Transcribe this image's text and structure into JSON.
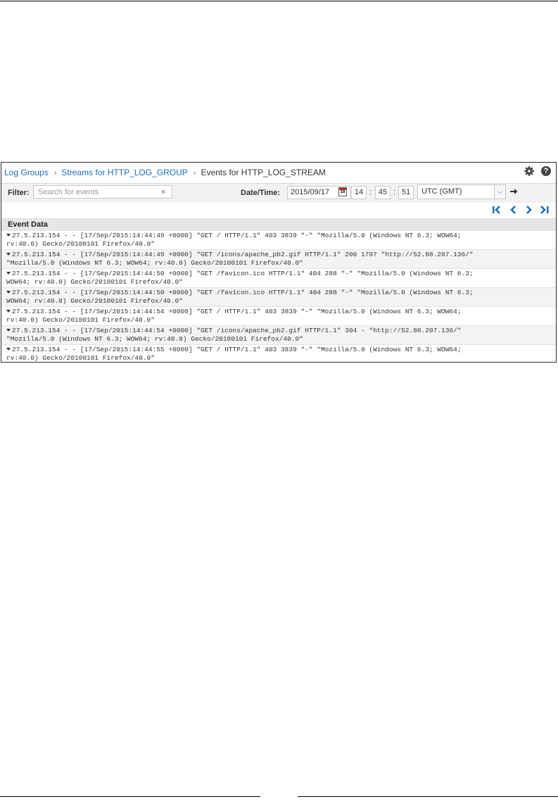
{
  "breadcrumb": {
    "log_groups": "Log Groups",
    "streams": "Streams for HTTP_LOG_GROUP",
    "events": "Events for HTTP_LOG_STREAM"
  },
  "filter": {
    "label": "Filter:",
    "placeholder": "Search for events",
    "clear_glyph": "×"
  },
  "datetime": {
    "label": "Date/Time:",
    "date": "2015/09/17",
    "calendar_day": "18",
    "hour": "14",
    "minute": "45",
    "second": "51",
    "separator": ":",
    "timezone": "UTC (GMT)"
  },
  "table": {
    "header": "Event Data"
  },
  "events": [
    {
      "line1": "27.5.213.154 - - [17/Sep/2015:14:44:49 +0000] \"GET / HTTP/1.1\" 403 3839 \"-\" \"Mozilla/5.0 (Windows NT 6.3; WOW64;",
      "line2": "rv:40.0) Gecko/20100101 Firefox/40.0\""
    },
    {
      "line1": "27.5.213.154 - - [17/Sep/2015:14:44:49 +0000] \"GET /icons/apache_pb2.gif HTTP/1.1\" 200 1797 \"http://52.88.207.136/\"",
      "line2": "\"Mozilla/5.0 (Windows NT 6.3; WOW64; rv:40.0) Gecko/20100101 Firefox/40.0\""
    },
    {
      "line1": "27.5.213.154 - - [17/Sep/2015:14:44:50 +0000] \"GET /favicon.ico HTTP/1.1\" 404 288 \"-\" \"Mozilla/5.0 (Windows NT 6.3;",
      "line2": "WOW64; rv:40.0) Gecko/20100101 Firefox/40.0\""
    },
    {
      "line1": "27.5.213.154 - - [17/Sep/2015:14:44:50 +0000] \"GET /favicon.ico HTTP/1.1\" 404 288 \"-\" \"Mozilla/5.0 (Windows NT 6.3;",
      "line2": "WOW64; rv:40.0) Gecko/20100101 Firefox/40.0\""
    },
    {
      "line1": "27.5.213.154 - - [17/Sep/2015:14:44:54 +0000] \"GET / HTTP/1.1\" 403 3839 \"-\" \"Mozilla/5.0 (Windows NT 6.3; WOW64;",
      "line2": "rv:40.0) Gecko/20100101 Firefox/40.0\""
    },
    {
      "line1": "27.5.213.154 - - [17/Sep/2015:14:44:54 +0000] \"GET /icons/apache_pb2.gif HTTP/1.1\" 304 - \"http://52.88.207.136/\"",
      "line2": "\"Mozilla/5.0 (Windows NT 6.3; WOW64; rv:40.0) Gecko/20100101 Firefox/40.0\""
    },
    {
      "line1": "27.5.213.154 - - [17/Sep/2015:14:44:55 +0000] \"GET / HTTP/1.1\" 403 3839 \"-\" \"Mozilla/5.0 (Windows NT 6.3; WOW64;",
      "line2": "rv:40.0) Gecko/20100101 Firefox/40.0\""
    }
  ],
  "icons": {
    "settings": "gear-icon",
    "help": "help-icon",
    "clear": "close-icon",
    "calendar": "calendar-icon",
    "go": "arrow-right-icon",
    "first": "first-page-icon",
    "previous": "previous-page-icon",
    "next": "next-page-icon",
    "last": "last-page-icon"
  },
  "colors": {
    "link": "#1a6ebd",
    "pager": "#1a6ebd",
    "header_bg": "#e6e6e6",
    "alt_row_bg": "#f3f3f3"
  }
}
